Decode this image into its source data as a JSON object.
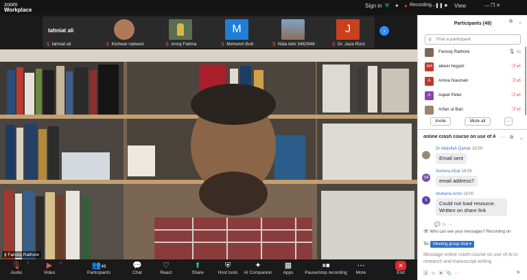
{
  "app": {
    "line1": "zoom",
    "line2": "Workplace"
  },
  "titlebar": {
    "signin": "Sign in",
    "recording": "Recording...",
    "view": "View",
    "recording_controls": "❚❚ ■",
    "window_controls": "—   ❐   ✕"
  },
  "strip": {
    "tiles": [
      {
        "name": "tahniat ali",
        "initial": "tahniat ali",
        "color": "#2a2a2a"
      },
      {
        "name": "Kishwar naheed",
        "initial": "",
        "color": "#b07a5a"
      },
      {
        "name": "Arooj Fatima",
        "initial": "",
        "color": "#c9a24a"
      },
      {
        "name": "Mehwish Butt",
        "initial": "M",
        "color": "#1f7fd8"
      },
      {
        "name": "Nida ilahi 3462948",
        "initial": "",
        "color": "#8c6f58"
      },
      {
        "name": "Dr. Jaza Rizvi",
        "initial": "J",
        "color": "#c8401e"
      }
    ],
    "next": "›"
  },
  "video": {
    "speaker": "Farooq Rathore"
  },
  "toolbar": {
    "audio": "Audio",
    "video": "Video",
    "participants": "Participants",
    "participants_count": "49",
    "chat": "Chat",
    "react": "React",
    "share": "Share",
    "host_tools": "Host tools",
    "ai_companion": "AI Companion",
    "apps": "Apps",
    "recording": "Pause/stop recording",
    "more": "More",
    "end": "End"
  },
  "panel": {
    "title": "Participants (49)",
    "search_placeholder": "Find a participant",
    "participants": [
      {
        "name": "Farooq Rathore",
        "initials": "",
        "color": "#7a6a5a"
      },
      {
        "name": "abeer hegazi",
        "initials": "AH",
        "color": "#c0392b"
      },
      {
        "name": "Amna Nauman",
        "initials": "A",
        "color": "#c0392b"
      },
      {
        "name": "Aqeel Peter",
        "initials": "A",
        "color": "#8e44ad"
      },
      {
        "name": "Arfan ul Bari",
        "initials": "",
        "color": "#a0826d"
      }
    ],
    "invite": "Invite",
    "mute_all": "Mute all",
    "more": "···"
  },
  "chat": {
    "title": "online crash course on use of AI i...",
    "messages": [
      {
        "sender": "Dr Abdullah Qamar",
        "time": "18:59",
        "text": "Email sent",
        "initials": "",
        "color": "#9b8a7a"
      },
      {
        "sender": "Sumera Afzal",
        "time": "18:59",
        "text": "email address?",
        "initials": "SA",
        "color": "#7d4fa8"
      },
      {
        "sender": "shahana Arshi",
        "time": "19:00",
        "text": "Could not load resource. Written on share link",
        "initials": "S",
        "color": "#5b3fa8"
      }
    ],
    "who_can_see": "Who can see your messages? Recording on",
    "to_label": "To:",
    "to_value": "Meeting group chat ▾",
    "compose": "Message online crash course on use of AI in research and manuscript writing"
  }
}
